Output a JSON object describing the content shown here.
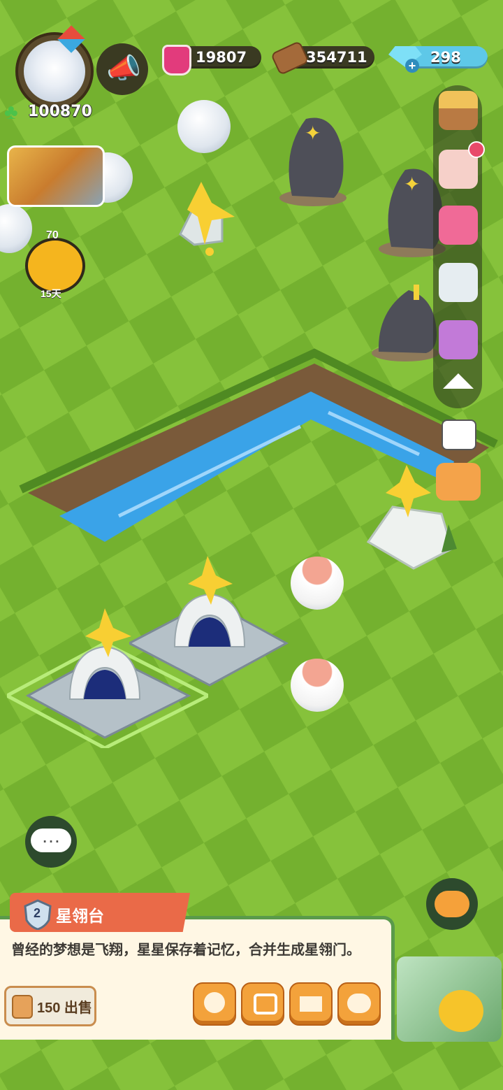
{
  "resources": {
    "potion_icon": "pink-potion-icon",
    "potion": "19807",
    "wood_icon": "wood-log-icon",
    "wood": "354711",
    "gem_icon": "blue-gem-icon",
    "gems": "298"
  },
  "player": {
    "avatar_icon": "sheep-avatar-icon",
    "clover_score": "100870"
  },
  "events": {
    "timer_count": "70",
    "timer_days": "15天"
  },
  "side_menu": [
    {
      "name": "shop-icon"
    },
    {
      "name": "friends-icon"
    },
    {
      "name": "book-icon"
    },
    {
      "name": "remote-icon"
    },
    {
      "name": "cat-collection-icon"
    },
    {
      "name": "collapse-arrow-icon"
    }
  ],
  "selected_item": {
    "level": "2",
    "name": "星翎台",
    "description": "曾经的梦想是飞翔，星星保存着记忆，合并生成星翎门。",
    "sell_label": "150 出售"
  },
  "actions": [
    {
      "name": "chick-action-icon"
    },
    {
      "name": "unlock-icon"
    },
    {
      "name": "store-box-icon"
    },
    {
      "name": "cat-face-icon"
    }
  ],
  "colors": {
    "grass_light": "#8cc63f",
    "grass_dark": "#6fae2e",
    "water": "#3aa3e8",
    "banner": "#ea6a48",
    "action_orange": "#f3a23b"
  }
}
